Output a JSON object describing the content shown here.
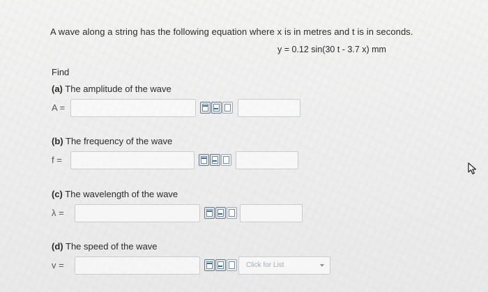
{
  "problem": {
    "statement": "A wave along a string has the following equation where x is in metres and t is in seconds.",
    "equation": "y = 0.12 sin(30 t - 3.7 x) mm"
  },
  "find_label": "Find",
  "parts": [
    {
      "tag": "(a)",
      "label": "The amplitude of the wave",
      "var": "A =",
      "value": ""
    },
    {
      "tag": "(b)",
      "label": "The frequency of the wave",
      "var": "f =",
      "value": ""
    },
    {
      "tag": "(c)",
      "label": "The wavelength of the wave",
      "var": "λ =",
      "value": ""
    },
    {
      "tag": "(d)",
      "label": "The speed of the wave",
      "var": "v =",
      "value": "",
      "unit_placeholder": "Click for List"
    }
  ],
  "icons": [
    "formula-editor-icon",
    "upload-image-icon",
    "attach-file-icon"
  ],
  "colors": {
    "input_border": "#c8cccf",
    "icon_border": "#6d7a86",
    "icon_accent": "#2f6fa5"
  }
}
